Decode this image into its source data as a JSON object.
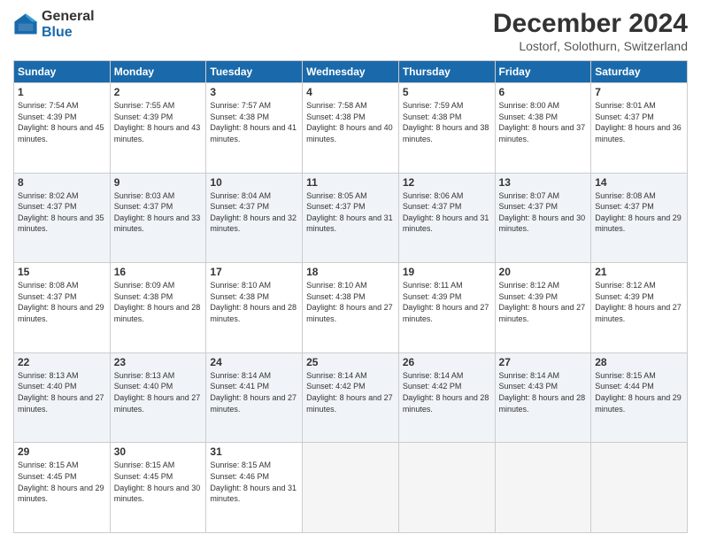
{
  "logo": {
    "general": "General",
    "blue": "Blue"
  },
  "title": "December 2024",
  "subtitle": "Lostorf, Solothurn, Switzerland",
  "days_of_week": [
    "Sunday",
    "Monday",
    "Tuesday",
    "Wednesday",
    "Thursday",
    "Friday",
    "Saturday"
  ],
  "weeks": [
    [
      {
        "day": "1",
        "sunrise": "7:54 AM",
        "sunset": "4:39 PM",
        "daylight": "8 hours and 45 minutes."
      },
      {
        "day": "2",
        "sunrise": "7:55 AM",
        "sunset": "4:39 PM",
        "daylight": "8 hours and 43 minutes."
      },
      {
        "day": "3",
        "sunrise": "7:57 AM",
        "sunset": "4:38 PM",
        "daylight": "8 hours and 41 minutes."
      },
      {
        "day": "4",
        "sunrise": "7:58 AM",
        "sunset": "4:38 PM",
        "daylight": "8 hours and 40 minutes."
      },
      {
        "day": "5",
        "sunrise": "7:59 AM",
        "sunset": "4:38 PM",
        "daylight": "8 hours and 38 minutes."
      },
      {
        "day": "6",
        "sunrise": "8:00 AM",
        "sunset": "4:38 PM",
        "daylight": "8 hours and 37 minutes."
      },
      {
        "day": "7",
        "sunrise": "8:01 AM",
        "sunset": "4:37 PM",
        "daylight": "8 hours and 36 minutes."
      }
    ],
    [
      {
        "day": "8",
        "sunrise": "8:02 AM",
        "sunset": "4:37 PM",
        "daylight": "8 hours and 35 minutes."
      },
      {
        "day": "9",
        "sunrise": "8:03 AM",
        "sunset": "4:37 PM",
        "daylight": "8 hours and 33 minutes."
      },
      {
        "day": "10",
        "sunrise": "8:04 AM",
        "sunset": "4:37 PM",
        "daylight": "8 hours and 32 minutes."
      },
      {
        "day": "11",
        "sunrise": "8:05 AM",
        "sunset": "4:37 PM",
        "daylight": "8 hours and 31 minutes."
      },
      {
        "day": "12",
        "sunrise": "8:06 AM",
        "sunset": "4:37 PM",
        "daylight": "8 hours and 31 minutes."
      },
      {
        "day": "13",
        "sunrise": "8:07 AM",
        "sunset": "4:37 PM",
        "daylight": "8 hours and 30 minutes."
      },
      {
        "day": "14",
        "sunrise": "8:08 AM",
        "sunset": "4:37 PM",
        "daylight": "8 hours and 29 minutes."
      }
    ],
    [
      {
        "day": "15",
        "sunrise": "8:08 AM",
        "sunset": "4:37 PM",
        "daylight": "8 hours and 29 minutes."
      },
      {
        "day": "16",
        "sunrise": "8:09 AM",
        "sunset": "4:38 PM",
        "daylight": "8 hours and 28 minutes."
      },
      {
        "day": "17",
        "sunrise": "8:10 AM",
        "sunset": "4:38 PM",
        "daylight": "8 hours and 28 minutes."
      },
      {
        "day": "18",
        "sunrise": "8:10 AM",
        "sunset": "4:38 PM",
        "daylight": "8 hours and 27 minutes."
      },
      {
        "day": "19",
        "sunrise": "8:11 AM",
        "sunset": "4:39 PM",
        "daylight": "8 hours and 27 minutes."
      },
      {
        "day": "20",
        "sunrise": "8:12 AM",
        "sunset": "4:39 PM",
        "daylight": "8 hours and 27 minutes."
      },
      {
        "day": "21",
        "sunrise": "8:12 AM",
        "sunset": "4:39 PM",
        "daylight": "8 hours and 27 minutes."
      }
    ],
    [
      {
        "day": "22",
        "sunrise": "8:13 AM",
        "sunset": "4:40 PM",
        "daylight": "8 hours and 27 minutes."
      },
      {
        "day": "23",
        "sunrise": "8:13 AM",
        "sunset": "4:40 PM",
        "daylight": "8 hours and 27 minutes."
      },
      {
        "day": "24",
        "sunrise": "8:14 AM",
        "sunset": "4:41 PM",
        "daylight": "8 hours and 27 minutes."
      },
      {
        "day": "25",
        "sunrise": "8:14 AM",
        "sunset": "4:42 PM",
        "daylight": "8 hours and 27 minutes."
      },
      {
        "day": "26",
        "sunrise": "8:14 AM",
        "sunset": "4:42 PM",
        "daylight": "8 hours and 28 minutes."
      },
      {
        "day": "27",
        "sunrise": "8:14 AM",
        "sunset": "4:43 PM",
        "daylight": "8 hours and 28 minutes."
      },
      {
        "day": "28",
        "sunrise": "8:15 AM",
        "sunset": "4:44 PM",
        "daylight": "8 hours and 29 minutes."
      }
    ],
    [
      {
        "day": "29",
        "sunrise": "8:15 AM",
        "sunset": "4:45 PM",
        "daylight": "8 hours and 29 minutes."
      },
      {
        "day": "30",
        "sunrise": "8:15 AM",
        "sunset": "4:45 PM",
        "daylight": "8 hours and 30 minutes."
      },
      {
        "day": "31",
        "sunrise": "8:15 AM",
        "sunset": "4:46 PM",
        "daylight": "8 hours and 31 minutes."
      },
      null,
      null,
      null,
      null
    ]
  ]
}
